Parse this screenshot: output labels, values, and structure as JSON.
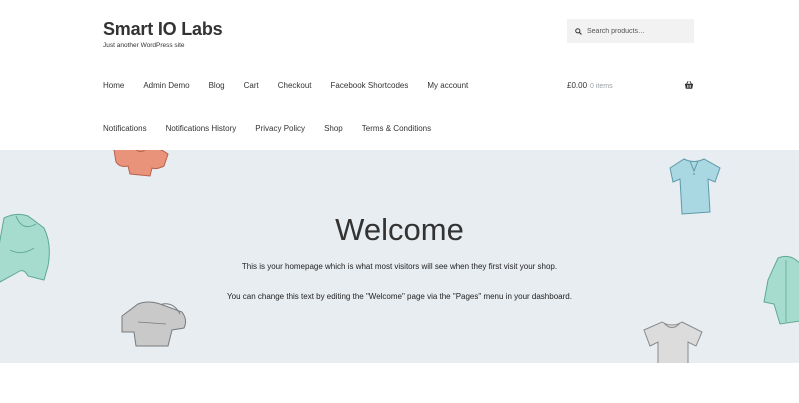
{
  "site": {
    "title": "Smart IO Labs",
    "tagline": "Just another WordPress site"
  },
  "search": {
    "placeholder": "Search products…"
  },
  "nav": {
    "row1": [
      "Home",
      "Admin Demo",
      "Blog",
      "Cart",
      "Checkout",
      "Facebook Shortcodes",
      "My account"
    ],
    "row2": [
      "Notifications",
      "Notifications History",
      "Privacy Policy",
      "Shop",
      "Terms & Conditions"
    ]
  },
  "cart": {
    "total": "£0.00",
    "count": "0 items"
  },
  "hero": {
    "title": "Welcome",
    "line1": "This is your homepage which is what most visitors will see when they first visit your shop.",
    "line2": "You can change this text by editing the \"Welcome\" page via the \"Pages\" menu in your dashboard."
  },
  "colors": {
    "hero_background": "#e8edf1",
    "search_background": "#f2f2f2",
    "text": "#333333",
    "muted": "#9aa0a6"
  },
  "icons": [
    "search-icon",
    "basket-icon"
  ]
}
